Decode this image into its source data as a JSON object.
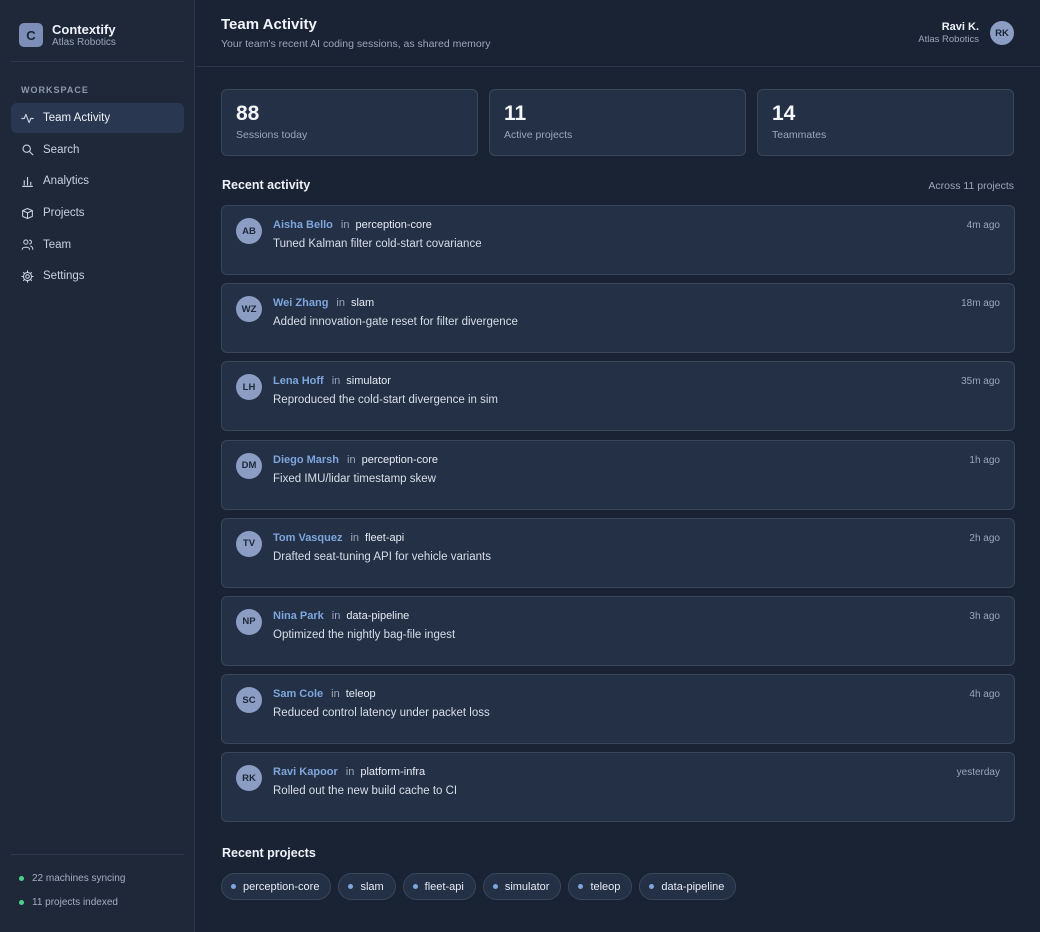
{
  "brand": {
    "logo_letter": "C",
    "name": "Contextify",
    "org": "Atlas Robotics"
  },
  "sidebar": {
    "section_label": "WORKSPACE",
    "items": [
      {
        "label": "Team Activity",
        "icon": "activity-icon",
        "active": true
      },
      {
        "label": "Search",
        "icon": "search-icon"
      },
      {
        "label": "Analytics",
        "icon": "bar-chart-icon"
      },
      {
        "label": "Projects",
        "icon": "box-icon"
      },
      {
        "label": "Team",
        "icon": "users-icon"
      },
      {
        "label": "Settings",
        "icon": "gear-icon"
      }
    ],
    "status": [
      {
        "text": "22 machines syncing",
        "color": "#4fd08a"
      },
      {
        "text": "11 projects indexed",
        "color": "#4fd08a"
      }
    ]
  },
  "header": {
    "title": "Team Activity",
    "subtitle": "Your team's recent AI coding sessions, as shared memory",
    "user": {
      "name": "Ravi K.",
      "org": "Atlas Robotics",
      "initials": "RK"
    }
  },
  "stats": [
    {
      "value": "88",
      "label": "Sessions today"
    },
    {
      "value": "11",
      "label": "Active projects"
    },
    {
      "value": "14",
      "label": "Teammates"
    }
  ],
  "activity": {
    "title": "Recent activity",
    "meta": "Across 11 projects",
    "in_word": "in",
    "items": [
      {
        "initials": "AB",
        "user": "Aisha Bello",
        "project": "perception-core",
        "desc": "Tuned Kalman filter cold-start covariance",
        "time": "4m ago"
      },
      {
        "initials": "WZ",
        "user": "Wei Zhang",
        "project": "slam",
        "desc": "Added innovation-gate reset for filter divergence",
        "time": "18m ago"
      },
      {
        "initials": "LH",
        "user": "Lena Hoff",
        "project": "simulator",
        "desc": "Reproduced the cold-start divergence in sim",
        "time": "35m ago"
      },
      {
        "initials": "DM",
        "user": "Diego Marsh",
        "project": "perception-core",
        "desc": "Fixed IMU/lidar timestamp skew",
        "time": "1h ago"
      },
      {
        "initials": "TV",
        "user": "Tom Vasquez",
        "project": "fleet-api",
        "desc": "Drafted seat-tuning API for vehicle variants",
        "time": "2h ago"
      },
      {
        "initials": "NP",
        "user": "Nina Park",
        "project": "data-pipeline",
        "desc": "Optimized the nightly bag-file ingest",
        "time": "3h ago"
      },
      {
        "initials": "SC",
        "user": "Sam Cole",
        "project": "teleop",
        "desc": "Reduced control latency under packet loss",
        "time": "4h ago"
      },
      {
        "initials": "RK",
        "user": "Ravi Kapoor",
        "project": "platform-infra",
        "desc": "Rolled out the new build cache to CI",
        "time": "yesterday"
      }
    ]
  },
  "projects": {
    "title": "Recent projects",
    "items": [
      "perception-core",
      "slam",
      "fleet-api",
      "simulator",
      "teleop",
      "data-pipeline"
    ]
  },
  "colors": {
    "background": "#1a2334",
    "sidebar": "#1e2839",
    "card": "#233045",
    "accent": "#7ea6dd",
    "avatar": "#8c9dc4",
    "status_ok": "#4fd08a"
  }
}
